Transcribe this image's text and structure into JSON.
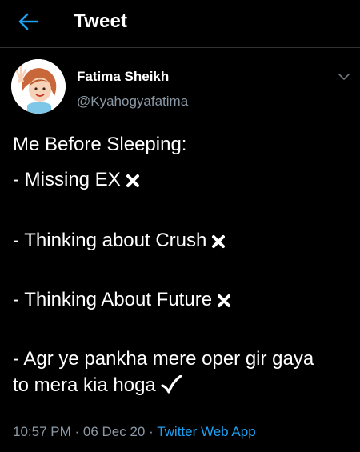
{
  "header": {
    "title": "Tweet",
    "back_icon": "arrow-left-icon",
    "accent": "#1da1f2"
  },
  "tweet": {
    "author": {
      "name": "Fatima Sheikh",
      "handle": "@Kyahogyafatima"
    },
    "lines": [
      "Me Before Sleeping:",
      "- Missing EX",
      "- Thinking about Crush",
      "- Thinking About Future",
      "- Agr ye pankha mere oper gir gaya",
      "to mera kia hoga"
    ],
    "line_icons": [
      "",
      "cross-mark-icon",
      "cross-mark-icon",
      "cross-mark-icon",
      "",
      "check-mark-icon"
    ],
    "meta": {
      "time": "10:57 PM",
      "date": "06 Dec 20",
      "separator": " · ",
      "source": "Twitter Web App"
    }
  },
  "colors": {
    "background": "#000000",
    "text": "#ffffff",
    "secondary": "#8b98a5",
    "link": "#1da1f2",
    "divider": "#2f3336"
  }
}
